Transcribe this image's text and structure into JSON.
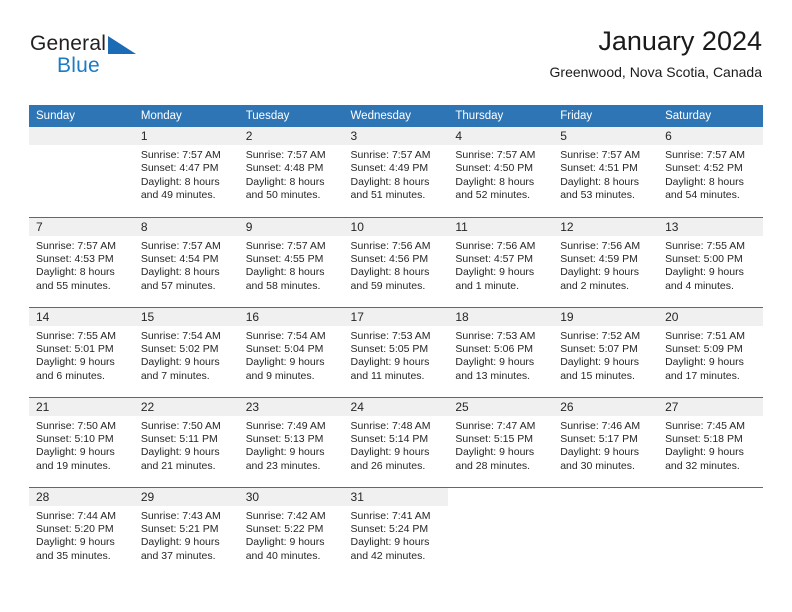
{
  "brand": {
    "name_top": "General",
    "name_bottom": "Blue",
    "triangle_color": "#1b6cb5",
    "blue_color": "#1b7cc4"
  },
  "header": {
    "title": "January 2024",
    "subtitle": "Greenwood, Nova Scotia, Canada",
    "header_bg": "#2e75b6",
    "header_text_color": "#ffffff"
  },
  "weekday_headers": [
    "Sunday",
    "Monday",
    "Tuesday",
    "Wednesday",
    "Thursday",
    "Friday",
    "Saturday"
  ],
  "weeks": [
    [
      {
        "day": "",
        "sunrise": "",
        "sunset": "",
        "daylight_1": "",
        "daylight_2": "",
        "blank": false
      },
      {
        "day": "1",
        "sunrise": "Sunrise: 7:57 AM",
        "sunset": "Sunset: 4:47 PM",
        "daylight_1": "Daylight: 8 hours",
        "daylight_2": "and 49 minutes."
      },
      {
        "day": "2",
        "sunrise": "Sunrise: 7:57 AM",
        "sunset": "Sunset: 4:48 PM",
        "daylight_1": "Daylight: 8 hours",
        "daylight_2": "and 50 minutes."
      },
      {
        "day": "3",
        "sunrise": "Sunrise: 7:57 AM",
        "sunset": "Sunset: 4:49 PM",
        "daylight_1": "Daylight: 8 hours",
        "daylight_2": "and 51 minutes."
      },
      {
        "day": "4",
        "sunrise": "Sunrise: 7:57 AM",
        "sunset": "Sunset: 4:50 PM",
        "daylight_1": "Daylight: 8 hours",
        "daylight_2": "and 52 minutes."
      },
      {
        "day": "5",
        "sunrise": "Sunrise: 7:57 AM",
        "sunset": "Sunset: 4:51 PM",
        "daylight_1": "Daylight: 8 hours",
        "daylight_2": "and 53 minutes."
      },
      {
        "day": "6",
        "sunrise": "Sunrise: 7:57 AM",
        "sunset": "Sunset: 4:52 PM",
        "daylight_1": "Daylight: 8 hours",
        "daylight_2": "and 54 minutes."
      }
    ],
    [
      {
        "day": "7",
        "sunrise": "Sunrise: 7:57 AM",
        "sunset": "Sunset: 4:53 PM",
        "daylight_1": "Daylight: 8 hours",
        "daylight_2": "and 55 minutes."
      },
      {
        "day": "8",
        "sunrise": "Sunrise: 7:57 AM",
        "sunset": "Sunset: 4:54 PM",
        "daylight_1": "Daylight: 8 hours",
        "daylight_2": "and 57 minutes."
      },
      {
        "day": "9",
        "sunrise": "Sunrise: 7:57 AM",
        "sunset": "Sunset: 4:55 PM",
        "daylight_1": "Daylight: 8 hours",
        "daylight_2": "and 58 minutes."
      },
      {
        "day": "10",
        "sunrise": "Sunrise: 7:56 AM",
        "sunset": "Sunset: 4:56 PM",
        "daylight_1": "Daylight: 8 hours",
        "daylight_2": "and 59 minutes."
      },
      {
        "day": "11",
        "sunrise": "Sunrise: 7:56 AM",
        "sunset": "Sunset: 4:57 PM",
        "daylight_1": "Daylight: 9 hours",
        "daylight_2": "and 1 minute."
      },
      {
        "day": "12",
        "sunrise": "Sunrise: 7:56 AM",
        "sunset": "Sunset: 4:59 PM",
        "daylight_1": "Daylight: 9 hours",
        "daylight_2": "and 2 minutes."
      },
      {
        "day": "13",
        "sunrise": "Sunrise: 7:55 AM",
        "sunset": "Sunset: 5:00 PM",
        "daylight_1": "Daylight: 9 hours",
        "daylight_2": "and 4 minutes."
      }
    ],
    [
      {
        "day": "14",
        "sunrise": "Sunrise: 7:55 AM",
        "sunset": "Sunset: 5:01 PM",
        "daylight_1": "Daylight: 9 hours",
        "daylight_2": "and 6 minutes."
      },
      {
        "day": "15",
        "sunrise": "Sunrise: 7:54 AM",
        "sunset": "Sunset: 5:02 PM",
        "daylight_1": "Daylight: 9 hours",
        "daylight_2": "and 7 minutes."
      },
      {
        "day": "16",
        "sunrise": "Sunrise: 7:54 AM",
        "sunset": "Sunset: 5:04 PM",
        "daylight_1": "Daylight: 9 hours",
        "daylight_2": "and 9 minutes."
      },
      {
        "day": "17",
        "sunrise": "Sunrise: 7:53 AM",
        "sunset": "Sunset: 5:05 PM",
        "daylight_1": "Daylight: 9 hours",
        "daylight_2": "and 11 minutes."
      },
      {
        "day": "18",
        "sunrise": "Sunrise: 7:53 AM",
        "sunset": "Sunset: 5:06 PM",
        "daylight_1": "Daylight: 9 hours",
        "daylight_2": "and 13 minutes."
      },
      {
        "day": "19",
        "sunrise": "Sunrise: 7:52 AM",
        "sunset": "Sunset: 5:07 PM",
        "daylight_1": "Daylight: 9 hours",
        "daylight_2": "and 15 minutes."
      },
      {
        "day": "20",
        "sunrise": "Sunrise: 7:51 AM",
        "sunset": "Sunset: 5:09 PM",
        "daylight_1": "Daylight: 9 hours",
        "daylight_2": "and 17 minutes."
      }
    ],
    [
      {
        "day": "21",
        "sunrise": "Sunrise: 7:50 AM",
        "sunset": "Sunset: 5:10 PM",
        "daylight_1": "Daylight: 9 hours",
        "daylight_2": "and 19 minutes."
      },
      {
        "day": "22",
        "sunrise": "Sunrise: 7:50 AM",
        "sunset": "Sunset: 5:11 PM",
        "daylight_1": "Daylight: 9 hours",
        "daylight_2": "and 21 minutes."
      },
      {
        "day": "23",
        "sunrise": "Sunrise: 7:49 AM",
        "sunset": "Sunset: 5:13 PM",
        "daylight_1": "Daylight: 9 hours",
        "daylight_2": "and 23 minutes."
      },
      {
        "day": "24",
        "sunrise": "Sunrise: 7:48 AM",
        "sunset": "Sunset: 5:14 PM",
        "daylight_1": "Daylight: 9 hours",
        "daylight_2": "and 26 minutes."
      },
      {
        "day": "25",
        "sunrise": "Sunrise: 7:47 AM",
        "sunset": "Sunset: 5:15 PM",
        "daylight_1": "Daylight: 9 hours",
        "daylight_2": "and 28 minutes."
      },
      {
        "day": "26",
        "sunrise": "Sunrise: 7:46 AM",
        "sunset": "Sunset: 5:17 PM",
        "daylight_1": "Daylight: 9 hours",
        "daylight_2": "and 30 minutes."
      },
      {
        "day": "27",
        "sunrise": "Sunrise: 7:45 AM",
        "sunset": "Sunset: 5:18 PM",
        "daylight_1": "Daylight: 9 hours",
        "daylight_2": "and 32 minutes."
      }
    ],
    [
      {
        "day": "28",
        "sunrise": "Sunrise: 7:44 AM",
        "sunset": "Sunset: 5:20 PM",
        "daylight_1": "Daylight: 9 hours",
        "daylight_2": "and 35 minutes."
      },
      {
        "day": "29",
        "sunrise": "Sunrise: 7:43 AM",
        "sunset": "Sunset: 5:21 PM",
        "daylight_1": "Daylight: 9 hours",
        "daylight_2": "and 37 minutes."
      },
      {
        "day": "30",
        "sunrise": "Sunrise: 7:42 AM",
        "sunset": "Sunset: 5:22 PM",
        "daylight_1": "Daylight: 9 hours",
        "daylight_2": "and 40 minutes."
      },
      {
        "day": "31",
        "sunrise": "Sunrise: 7:41 AM",
        "sunset": "Sunset: 5:24 PM",
        "daylight_1": "Daylight: 9 hours",
        "daylight_2": "and 42 minutes."
      },
      {
        "day": "",
        "sunrise": "",
        "sunset": "",
        "daylight_1": "",
        "daylight_2": "",
        "blank": true
      },
      {
        "day": "",
        "sunrise": "",
        "sunset": "",
        "daylight_1": "",
        "daylight_2": "",
        "blank": true
      },
      {
        "day": "",
        "sunrise": "",
        "sunset": "",
        "daylight_1": "",
        "daylight_2": "",
        "blank": true
      }
    ]
  ]
}
